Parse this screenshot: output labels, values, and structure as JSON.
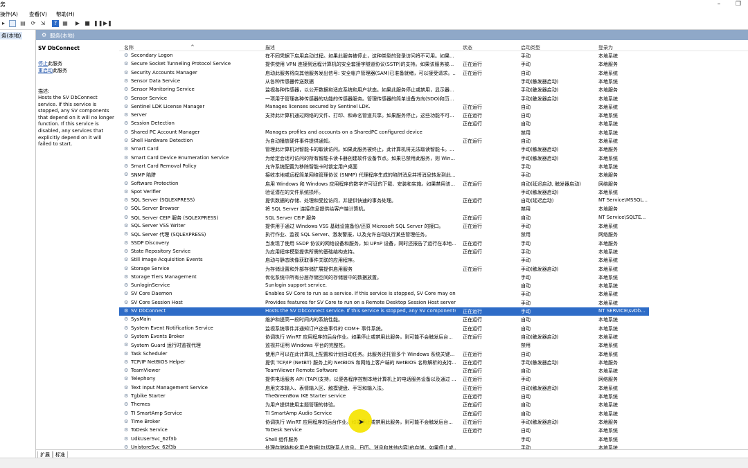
{
  "window": {
    "title_fragment": "务"
  },
  "menu": {
    "items": [
      "操作(A)",
      "查看(V)",
      "帮助(H)"
    ]
  },
  "tree": {
    "node_label": "务(本地)"
  },
  "pane_header": {
    "label": "服务(本地)"
  },
  "detail": {
    "service_name": "SV DbConnect",
    "stop_link": "停止",
    "stop_suffix": "此服务",
    "restart_link": "重启动",
    "restart_suffix": "此服务",
    "desc_label": "描述:",
    "desc_text": "Hosts the SV DbConnect service. If this service is stopped, any SV components that depend on it will no longer function. If this service is disabled, any services that explicitly depend on it will failed to start."
  },
  "columns": {
    "name": "名称",
    "description": "描述",
    "status": "状态",
    "startup": "启动类型",
    "logon": "登录为"
  },
  "rows": [
    {
      "name": "Secondary Logon",
      "desc": "在不同凭据下启用启动过程。如果此服务被停止，这种类型的登录访问将不可用。如果...",
      "status": "",
      "startup": "手动",
      "logon": "本地系统"
    },
    {
      "name": "Secure Socket Tunneling Protocol Service",
      "desc": "提供使用 VPN 连接到远程计算机的安全套接字隧道协议(SSTP)的支持。如果该服务被...",
      "status": "正在运行",
      "startup": "手动",
      "logon": "本地服务"
    },
    {
      "name": "Security Accounts Manager",
      "desc": "启动此服务将向其他服务发出信号: 安全帐户管理器(SAM)已准备就绪，可以接受请求。...",
      "status": "正在运行",
      "startup": "自动",
      "logon": "本地系统"
    },
    {
      "name": "Sensor Data Service",
      "desc": "从各种传感器传送数据",
      "status": "",
      "startup": "手动(触发器启动)",
      "logon": "本地系统"
    },
    {
      "name": "Sensor Monitoring Service",
      "desc": "监视各种传感器，以公开数据和适应系统和用户状态。如果此服务停止或禁用，显示器...",
      "status": "",
      "startup": "手动(触发器启动)",
      "logon": "本地服务"
    },
    {
      "name": "Sensor Service",
      "desc": "一项用于管理各种传感器的功能的传感器服务。管理传感器的简单设备方向(SDO)和历...",
      "status": "",
      "startup": "手动(触发器启动)",
      "logon": "本地系统"
    },
    {
      "name": "Sentinel LDK License Manager",
      "desc": "Manages licenses secured by Sentinel LDK.",
      "status": "正在运行",
      "startup": "自动",
      "logon": "本地系统"
    },
    {
      "name": "Server",
      "desc": "支持此计算机通过网络的文件、打印、和命名管道共享。如果服务停止，这些功能不可...",
      "status": "正在运行",
      "startup": "自动",
      "logon": "本地系统"
    },
    {
      "name": "Session Detection",
      "desc": "",
      "status": "正在运行",
      "startup": "自动",
      "logon": "本地系统"
    },
    {
      "name": "Shared PC Account Manager",
      "desc": "Manages profiles and accounts on a SharedPC configured device",
      "status": "",
      "startup": "禁用",
      "logon": "本地系统"
    },
    {
      "name": "Shell Hardware Detection",
      "desc": "为自动播放硬件事件提供通知。",
      "status": "正在运行",
      "startup": "自动",
      "logon": "本地系统"
    },
    {
      "name": "Smart Card",
      "desc": "管理此计算机对智能卡的取读访问。如果此服务被终止，此计算机将无法取读智能卡。...",
      "status": "",
      "startup": "手动(触发器启动)",
      "logon": "本地服务"
    },
    {
      "name": "Smart Card Device Enumeration Service",
      "desc": "为给定会话可访问的所有智能卡读卡器创建软件设备节点。如果已禁用此服务，则 Win...",
      "status": "",
      "startup": "手动(触发器启动)",
      "logon": "本地系统"
    },
    {
      "name": "Smart Card Removal Policy",
      "desc": "允许系统配置为移除智能卡时锁定用户桌面",
      "status": "",
      "startup": "手动",
      "logon": "本地系统"
    },
    {
      "name": "SNMP 陷阱",
      "desc": "接收本地或远程简单网络管理协议 (SNMP) 代理程序生成的陷阱消息并将消息转发到此...",
      "status": "",
      "startup": "手动",
      "logon": "本地服务"
    },
    {
      "name": "Software Protection",
      "desc": "启用 Windows 和 Windows 应用程序的数字许可证的下载、安装和实施。如果禁用该...",
      "status": "正在运行",
      "startup": "自动(延迟启动, 触发器启动)",
      "logon": "网络服务"
    },
    {
      "name": "Spot Verifier",
      "desc": "验证潜在的文件系统损坏。",
      "status": "",
      "startup": "手动(触发器启动)",
      "logon": "本地系统"
    },
    {
      "name": "SQL Server (SQLEXPRESS)",
      "desc": "提供数据的存储、处理和受控访问，并提供快速的事务处理。",
      "status": "正在运行",
      "startup": "自动(延迟启动)",
      "logon": "NT Service\\MSSQL..."
    },
    {
      "name": "SQL Server Browser",
      "desc": "将 SQL Server 连接信息提供给客户端计算机。",
      "status": "",
      "startup": "禁用",
      "logon": "本地服务"
    },
    {
      "name": "SQL Server CEIP 服务 (SQLEXPRESS)",
      "desc": "SQL Server CEIP 服务",
      "status": "正在运行",
      "startup": "自动",
      "logon": "NT Service\\SQLTE..."
    },
    {
      "name": "SQL Server VSS Writer",
      "desc": "提供用于通过 Windows VSS 基础设施备份/还原 Microsoft SQL Server 的接口。",
      "status": "正在运行",
      "startup": "手动",
      "logon": "本地系统"
    },
    {
      "name": "SQL Server 代理 (SQLEXPRESS)",
      "desc": "执行作业、监视 SQL Server、激发警报，以及允许自动执行某些管理任务。",
      "status": "",
      "startup": "禁用",
      "logon": "网络服务"
    },
    {
      "name": "SSDP Discovery",
      "desc": "当发现了使用 SSDP 协议的网络设备和服务，如 UPnP 设备，同时还报告了运行在本地...",
      "status": "正在运行",
      "startup": "手动",
      "logon": "本地服务"
    },
    {
      "name": "State Repository Service",
      "desc": "为应用程序模型提供所需的基础结构支持。",
      "status": "正在运行",
      "startup": "手动",
      "logon": "本地系统"
    },
    {
      "name": "Still Image Acquisition Events",
      "desc": "启动与静态映像获取事件关联的应用程序。",
      "status": "",
      "startup": "手动",
      "logon": "本地系统"
    },
    {
      "name": "Storage Service",
      "desc": "为存储设置和外部存储扩展提供启用服务",
      "status": "正在运行",
      "startup": "手动(触发器启动)",
      "logon": "本地系统"
    },
    {
      "name": "Storage Tiers Management",
      "desc": "优化系统中所有分层存储空间的存储层中的数据放置。",
      "status": "",
      "startup": "手动",
      "logon": "本地系统"
    },
    {
      "name": "SunloginService",
      "desc": "Sunlogin support service.",
      "status": "",
      "startup": "自动",
      "logon": "本地系统"
    },
    {
      "name": "SV Core Daemon",
      "desc": "Enables SV Core to run as a service. If this service is stopped, SV Core may onl...",
      "status": "",
      "startup": "手动",
      "logon": "本地系统"
    },
    {
      "name": "SV Core Session Host",
      "desc": "Provides features for SV Core to run on a Remote Desktop Session Host server...",
      "status": "",
      "startup": "手动",
      "logon": "本地系统"
    },
    {
      "name": "SV DbConnect",
      "desc": "Hosts the SV DbConnect service. If this service is stopped, any SV components ...",
      "status": "正在运行",
      "startup": "手动",
      "logon": "NT SERVICE\\svDb...",
      "selected": true
    },
    {
      "name": "SysMain",
      "desc": "维护和提高一段时间内的系统性能。",
      "status": "正在运行",
      "startup": "自动",
      "logon": "本地系统"
    },
    {
      "name": "System Event Notification Service",
      "desc": "监视系统事件并通知订户这些事件的 COM+ 事件系统。",
      "status": "正在运行",
      "startup": "自动",
      "logon": "本地系统"
    },
    {
      "name": "System Events Broker",
      "desc": "协调执行 WinRT 应用程序的后台作业。如果停止或禁用此服务，则可能不会触发后台...",
      "status": "正在运行",
      "startup": "自动(触发器启动)",
      "logon": "本地系统"
    },
    {
      "name": "System Guard 运行时监视代理",
      "desc": "监视并证明 Windows 平台的完整性。",
      "status": "",
      "startup": "禁用",
      "logon": "本地系统"
    },
    {
      "name": "Task Scheduler",
      "desc": "使用户可以在此计算机上配置和计划自动任务。此服务还托管多个 Windows 系统关键...",
      "status": "正在运行",
      "startup": "自动",
      "logon": "本地系统"
    },
    {
      "name": "TCP/IP NetBIOS Helper",
      "desc": "提供 TCP/IP (NetBT) 服务上的 NetBIOS 和网络上客户端的 NetBIOS 名称解析的支持...",
      "status": "正在运行",
      "startup": "手动(触发器启动)",
      "logon": "本地服务"
    },
    {
      "name": "TeamViewer",
      "desc": "TeamViewer Remote Software",
      "status": "正在运行",
      "startup": "自动",
      "logon": "本地系统"
    },
    {
      "name": "Telephony",
      "desc": "提供电话服务 API (TAPI)支持，以便各程序控制本地计算机上的电话服务设备以及通过 ...",
      "status": "正在运行",
      "startup": "手动",
      "logon": "网络服务"
    },
    {
      "name": "Text Input Management Service",
      "desc": "启用文本输入、表情输入区、触摸键盘、手写和输入法。",
      "status": "正在运行",
      "startup": "自动(触发器启动)",
      "logon": "本地系统"
    },
    {
      "name": "Tgbike Starter",
      "desc": "TheGreenBow IKE Starter service",
      "status": "正在运行",
      "startup": "自动",
      "logon": "本地系统"
    },
    {
      "name": "Themes",
      "desc": "为用户提供使用主题管理的体验。",
      "status": "正在运行",
      "startup": "自动",
      "logon": "本地系统"
    },
    {
      "name": "TI SmartAmp Service",
      "desc": "TI SmartAmp Audio Service",
      "status": "正在运行",
      "startup": "自动",
      "logon": "本地系统"
    },
    {
      "name": "Time Broker",
      "desc": "协调执行 WinRT 应用程序的后台作业。如果停止或禁用此服务，则可能不会触发后台...",
      "status": "正在运行",
      "startup": "手动(触发器启动)",
      "logon": "本地服务"
    },
    {
      "name": "ToDesk Service",
      "desc": "ToDesk Service",
      "status": "正在运行",
      "startup": "自动",
      "logon": "本地系统"
    },
    {
      "name": "UdkUserSvc_62f3b",
      "desc": "Shell 组件服务",
      "status": "",
      "startup": "手动",
      "logon": "本地系统"
    },
    {
      "name": "UnistoreSvc_62f3b",
      "desc": "处理存储结构化用户数据(包括联系人信息、日历、消息和其他内容)的存储。如果停止或...",
      "status": "",
      "startup": "手动",
      "logon": "本地系统"
    }
  ],
  "tabs": {
    "extended": "扩展",
    "standard": "标准"
  },
  "colors": {
    "selection": "#2e6cc7",
    "header": "#8fa8c8",
    "cursor_highlight": "#f5e400"
  }
}
